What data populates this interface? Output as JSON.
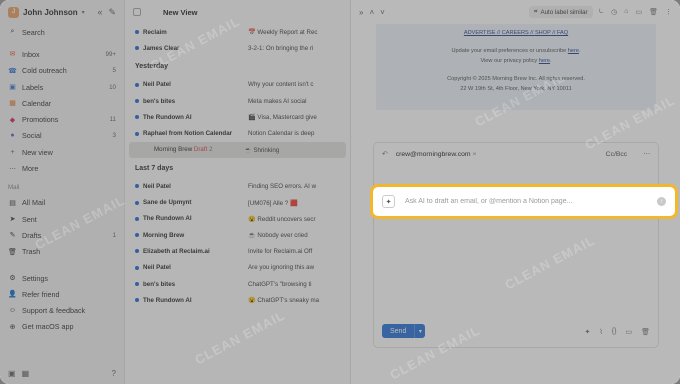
{
  "account": {
    "initial": "J",
    "name": "John Johnson"
  },
  "sidebar": {
    "search": "Search",
    "folders": [
      {
        "icon": "✉",
        "label": "Inbox",
        "count": "99+",
        "color": "#e05a3a"
      },
      {
        "icon": "☎",
        "label": "Cold outreach",
        "count": "5",
        "color": "#3a7bd5"
      },
      {
        "icon": "▣",
        "label": "Labels",
        "count": "10",
        "color": "#3a7bd5"
      },
      {
        "icon": "▦",
        "label": "Calendar",
        "count": "",
        "color": "#e07a2a"
      },
      {
        "icon": "◆",
        "label": "Promotions",
        "count": "11",
        "color": "#d6336c"
      },
      {
        "icon": "●",
        "label": "Social",
        "count": "3",
        "color": "#7b5bd6"
      },
      {
        "icon": "+",
        "label": "New view",
        "count": "",
        "color": "#666666"
      },
      {
        "icon": "⋯",
        "label": "More",
        "count": "",
        "color": "#666666"
      }
    ],
    "mail_section": "Mail",
    "mail_items": [
      {
        "icon": "▤",
        "label": "All Mail",
        "count": ""
      },
      {
        "icon": "➤",
        "label": "Sent",
        "count": ""
      },
      {
        "icon": "✎",
        "label": "Drafts",
        "count": "1"
      },
      {
        "icon": "🗑",
        "label": "Trash",
        "count": ""
      }
    ],
    "bottom_items": [
      {
        "icon": "⚙",
        "label": "Settings"
      },
      {
        "icon": "👤",
        "label": "Refer friend"
      },
      {
        "icon": "☺",
        "label": "Support & feedback"
      },
      {
        "icon": "⊕",
        "label": "Get macOS app"
      }
    ]
  },
  "list": {
    "view_title": "New View",
    "top_rows": [
      {
        "from": "Reclaim",
        "subject": "📅 Weekly Report at Rec"
      },
      {
        "from": "James Clear",
        "subject": "3-2-1: On bringing the ri"
      }
    ],
    "group_yesterday": "Yesterday",
    "yesterday_rows": [
      {
        "from": "Neil Patel",
        "subject": "Why your content isn't c"
      },
      {
        "from": "ben's bites",
        "subject": "Meta makes AI social"
      },
      {
        "from": "The Rundown AI",
        "subject": "🎬 Visa, Mastercard give"
      },
      {
        "from": "Raphael from Notion Calendar",
        "subject": "Notion Calendar is deep"
      }
    ],
    "selected_row": {
      "from": "Morning Brew",
      "draft": "Draft",
      "count": "2",
      "subject": "☕ Shrinking"
    },
    "group_last7": "Last 7 days",
    "last7_rows": [
      {
        "from": "Neil Patel",
        "subject": "Finding SEO errors. AI w"
      },
      {
        "from": "Sane de Upmynt",
        "subject": "[UM076] Alle ? 🟥"
      },
      {
        "from": "The Rundown AI",
        "subject": "😮 Reddit uncovers secr"
      },
      {
        "from": "Morning Brew",
        "subject": "☕ Nobody ever cried"
      },
      {
        "from": "Elizabeth at Reclaim.ai",
        "subject": "Invite for Reclaim.ai Off"
      },
      {
        "from": "Neil Patel",
        "subject": "Are you ignoring this aw"
      },
      {
        "from": "ben's bites",
        "subject": "ChatGPT's \"browsing ti"
      },
      {
        "from": "The Rundown AI",
        "subject": "😮 ChatGPT's sneaky ma"
      }
    ]
  },
  "pane": {
    "auto_label": "Auto label similar",
    "newsletter": {
      "links": [
        "ADVERTISE",
        "CAREERS",
        "SHOP",
        "FAQ"
      ],
      "link_sep": " // ",
      "prefs_text": "Update your email preferences or unsubscribe",
      "prefs_link": "here",
      "privacy_text": "View our privacy policy",
      "privacy_link": "here",
      "copyright": "Copyright © 2025 Morning Brew Inc. All rights reserved.",
      "address": "22 W 19th St, 4th Floor, New York, NY 10011"
    },
    "compose": {
      "recipient": "crew@morningbrew.com",
      "cc_bcc": "Cc/Bcc",
      "send": "Send"
    },
    "ai_prompt": {
      "placeholder": "Ask AI to draft an email, or @mention a Notion page..."
    }
  },
  "watermark": "CLEAN EMAIL",
  "colors": {
    "highlight": "#f3b72d",
    "accent": "#2f78d8"
  }
}
